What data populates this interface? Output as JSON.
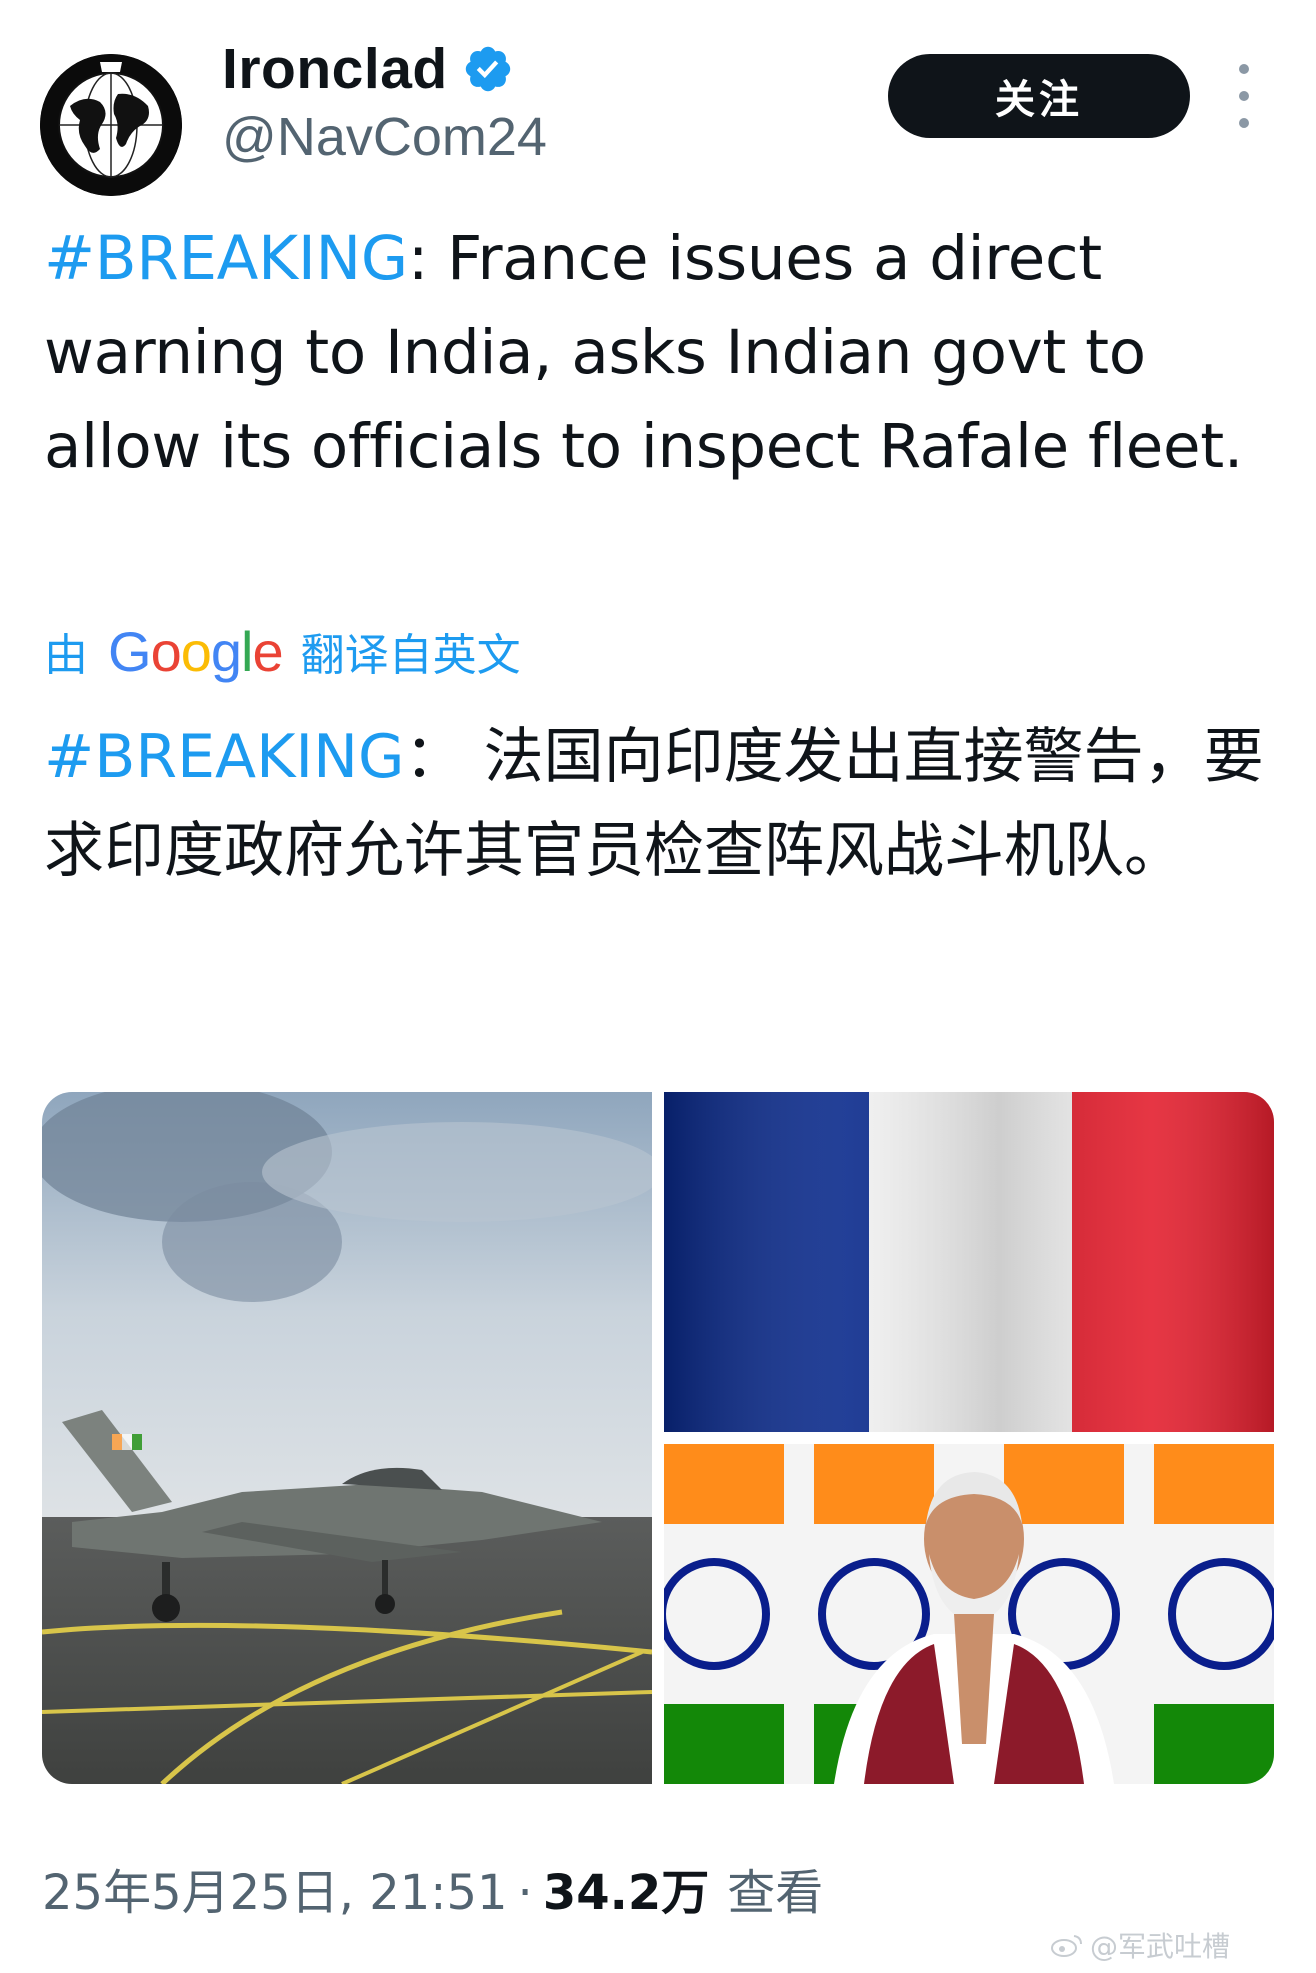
{
  "author": {
    "display_name": "Ironclad",
    "handle": "@NavCom24",
    "avatar_label": "IRONCLAD"
  },
  "actions": {
    "follow_label": "关注"
  },
  "tweet": {
    "hashtag": "#BREAKING",
    "body": ": France issues a direct warning to India, asks Indian govt to allow its officials to inspect Rafale fleet."
  },
  "translation": {
    "prefix": "由",
    "provider": "Google",
    "suffix": "翻译自英文",
    "hashtag": "#BREAKING",
    "body": "：  法国向印度发出直接警告，要求印度政府允许其官员检查阵风战斗机队。"
  },
  "media": {
    "images": [
      {
        "name": "rafale-jet-photo"
      },
      {
        "name": "france-flag-photo"
      },
      {
        "name": "modi-india-flags-photo"
      }
    ],
    "colors": {
      "france_blue": "#0a2a8c",
      "france_red": "#e3202f",
      "saffron": "#ff8c1a",
      "india_green": "#138808"
    }
  },
  "meta": {
    "date_time": "25年5月25日, 21:51",
    "separator": "·",
    "views_count": "34.2万",
    "views_label": "查看"
  },
  "watermark": {
    "text": "@军武吐槽"
  },
  "colors": {
    "link": "#1d9bf0",
    "verified": "#1d9bf0",
    "text": "#0f1419",
    "secondary": "#536471"
  }
}
